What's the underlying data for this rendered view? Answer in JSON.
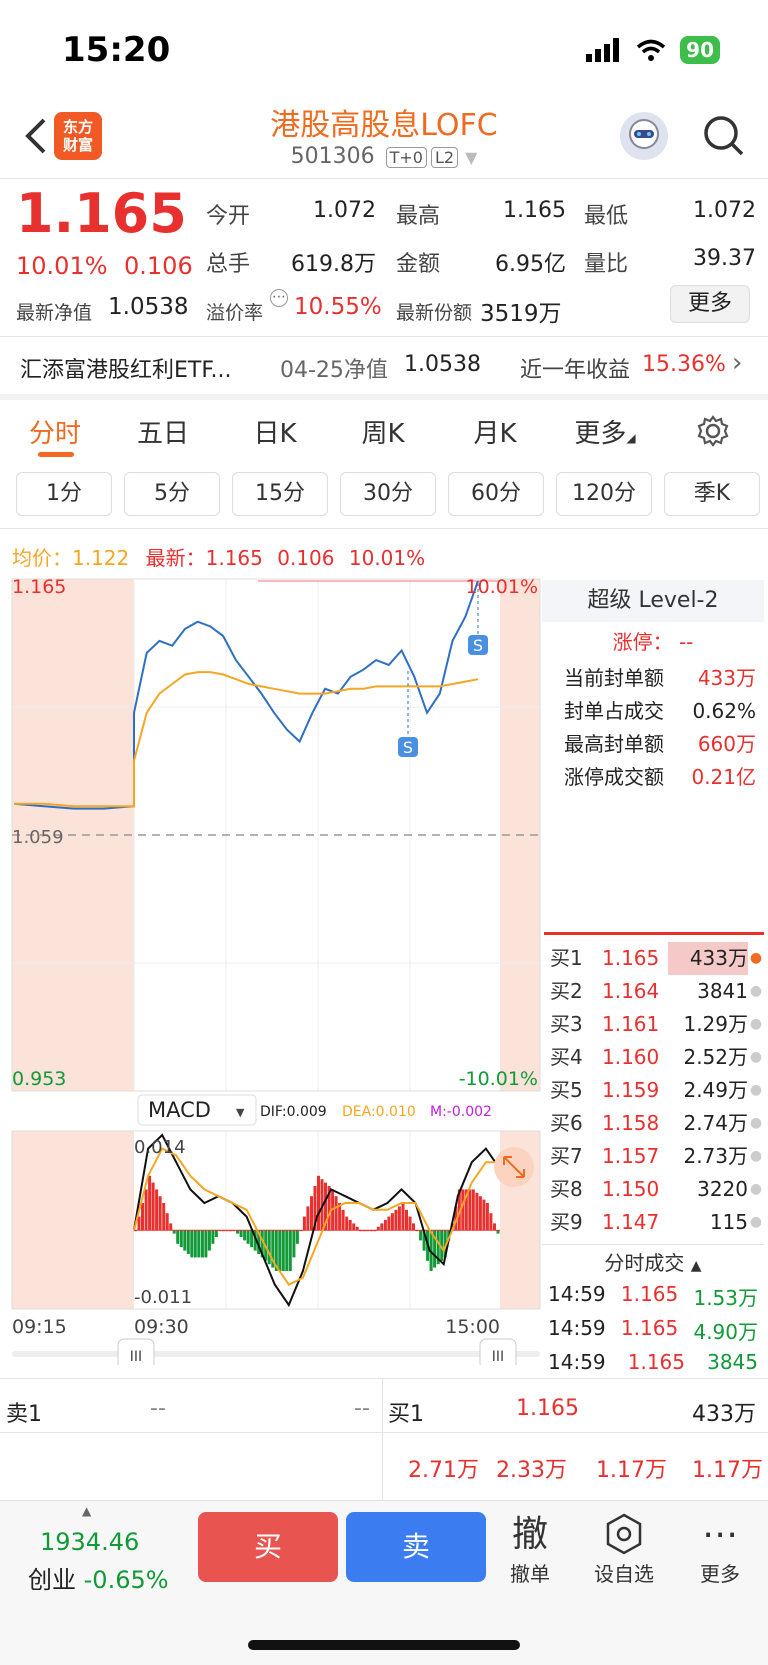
{
  "status": {
    "time": "15:20",
    "battery": "90"
  },
  "header": {
    "logo_line1": "东方",
    "logo_line2": "财富",
    "title": "港股高股息LOFC",
    "code": "501306",
    "tag1": "T+0",
    "tag2": "L2"
  },
  "quote": {
    "price": "1.165",
    "change_pct": "10.01%",
    "change": "0.106",
    "open_label": "今开",
    "open": "1.072",
    "high_label": "最高",
    "high": "1.165",
    "low_label": "最低",
    "low": "1.072",
    "volume_label": "总手",
    "volume": "619.8万",
    "amount_label": "金额",
    "amount": "6.95亿",
    "ratio_label": "量比",
    "ratio": "39.37",
    "nav_label": "最新净值",
    "nav": "1.0538",
    "premium_label": "溢价率",
    "premium": "10.55%",
    "shares_label": "最新份额",
    "shares": "3519万",
    "more": "更多"
  },
  "fund": {
    "name": "汇添富港股红利ETF...",
    "nav_date": "04-25净值",
    "nav": "1.0538",
    "year_label": "近一年收益",
    "year_return": "15.36%"
  },
  "period_tabs": [
    "分时",
    "五日",
    "日K",
    "周K",
    "月K",
    "更多"
  ],
  "minute_tabs": [
    "1分",
    "5分",
    "15分",
    "30分",
    "60分",
    "120分",
    "季K"
  ],
  "info": {
    "avg_label": "均价：",
    "avg": "1.122",
    "latest_label": "最新：",
    "latest": "1.165",
    "change": "0.106",
    "pct": "10.01%"
  },
  "chart": {
    "y_top": "1.165",
    "y_mid": "1.059",
    "y_bottom": "0.953",
    "pct_top": "10.01%",
    "pct_bottom": "-10.01%",
    "marker": "S",
    "macd_label": "MACD",
    "dif": "DIF:0.009",
    "dea": "DEA:0.010",
    "m": "M:-0.002",
    "macd_top": "0.014",
    "macd_bottom": "-0.011",
    "time_start": "09:15",
    "time_open": "09:30",
    "time_end": "15:00",
    "handle": "III"
  },
  "chart_data": {
    "type": "line",
    "x_range": [
      "09:15",
      "15:00"
    ],
    "ylim": [
      0.953,
      1.165
    ],
    "reference": 1.059,
    "series": [
      {
        "values": [
          1.072,
          1.071,
          1.07,
          1.07,
          1.071,
          1.11,
          1.135,
          1.14,
          1.138,
          1.145,
          1.148,
          1.146,
          1.142,
          1.132,
          1.125,
          1.118,
          1.11,
          1.103,
          1.098,
          1.11,
          1.12,
          1.118,
          1.125,
          1.128,
          1.132,
          1.13,
          1.136,
          1.125,
          1.11,
          1.118,
          1.14,
          1.15,
          1.165
        ]
      },
      {
        "values": [
          1.072,
          1.072,
          1.071,
          1.071,
          1.071,
          1.09,
          1.11,
          1.118,
          1.122,
          1.126,
          1.127,
          1.127,
          1.126,
          1.124,
          1.122,
          1.121,
          1.12,
          1.119,
          1.118,
          1.118,
          1.118,
          1.119,
          1.12,
          1.12,
          1.121,
          1.121,
          1.121,
          1.121,
          1.121,
          1.121,
          1.122,
          1.123,
          1.124
        ]
      }
    ],
    "macd": {
      "ylim": [
        -0.011,
        0.014
      ],
      "dif": [
        0.0,
        0.012,
        0.014,
        0.01,
        0.006,
        0.004,
        0.005,
        0.004,
        0.002,
        -0.003,
        -0.008,
        -0.011,
        -0.006,
        0.002,
        0.006,
        0.005,
        0.004,
        0.003,
        0.004,
        0.006,
        0.004,
        -0.003,
        -0.005,
        0.005,
        0.01,
        0.012,
        0.009
      ],
      "dea": [
        0.0,
        0.008,
        0.012,
        0.011,
        0.008,
        0.006,
        0.005,
        0.004,
        0.003,
        -0.001,
        -0.005,
        -0.008,
        -0.007,
        -0.002,
        0.003,
        0.004,
        0.004,
        0.003,
        0.003,
        0.004,
        0.004,
        0.0,
        -0.003,
        0.002,
        0.007,
        0.01,
        0.01
      ]
    }
  },
  "level2": {
    "title": "超级 Level-2",
    "limit_label": "涨停：",
    "limit_val": "--",
    "rows": [
      {
        "label": "当前封单额",
        "value": "433万",
        "color": "red"
      },
      {
        "label": "封单占成交",
        "value": "0.62%",
        "color": "dark"
      },
      {
        "label": "最高封单额",
        "value": "660万",
        "color": "red"
      },
      {
        "label": "涨停成交额",
        "value": "0.21亿",
        "color": "red"
      }
    ]
  },
  "book": [
    {
      "level": "买1",
      "price": "1.165",
      "vol": "433万"
    },
    {
      "level": "买2",
      "price": "1.164",
      "vol": "3841"
    },
    {
      "level": "买3",
      "price": "1.161",
      "vol": "1.29万"
    },
    {
      "level": "买4",
      "price": "1.160",
      "vol": "2.52万"
    },
    {
      "level": "买5",
      "price": "1.159",
      "vol": "2.49万"
    },
    {
      "level": "买6",
      "price": "1.158",
      "vol": "2.74万"
    },
    {
      "level": "买7",
      "price": "1.157",
      "vol": "2.73万"
    },
    {
      "level": "买8",
      "price": "1.150",
      "vol": "3220"
    },
    {
      "level": "买9",
      "price": "1.147",
      "vol": "115"
    }
  ],
  "trades_title": "分时成交",
  "trades": [
    {
      "time": "14:59",
      "price": "1.165",
      "vol": "1.53万"
    },
    {
      "time": "14:59",
      "price": "1.165",
      "vol": "4.90万"
    },
    {
      "time": "14:59",
      "price": "1.165",
      "vol": "3845"
    }
  ],
  "sellbuy": {
    "sell_label": "卖1",
    "sell_price": "--",
    "sell_vol": "--",
    "buy_label": "买1",
    "buy_price": "1.165",
    "buy_vol": "433万",
    "queue": [
      "2.71万",
      "2.33万",
      "1.17万",
      "1.17万"
    ]
  },
  "bottom": {
    "index_val": "1934.46",
    "index_name": "创业",
    "index_pct": "-0.65%",
    "buy": "买",
    "sell": "卖",
    "cancel_icon": "撤",
    "cancel": "撤单",
    "watch": "设自选",
    "more": "更多"
  },
  "colors": {
    "up": "#e8302f",
    "down": "#119a37",
    "accent": "#f06b1f",
    "line": "#2e6fc4",
    "avg": "#f5a623"
  }
}
